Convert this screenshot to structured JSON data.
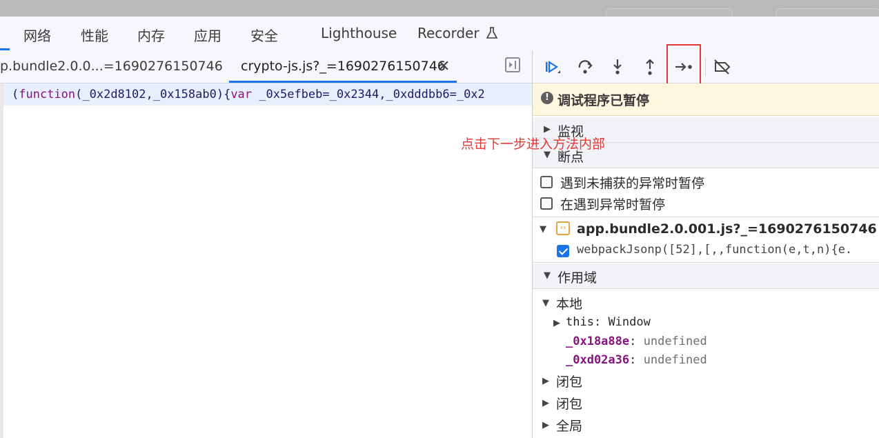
{
  "panel_tabs": [
    "网络",
    "性能",
    "内存",
    "应用",
    "安全",
    "Lighthouse",
    "Recorder"
  ],
  "file_tabs": {
    "first": "p.bundle2.0.0...=1690276150746",
    "second": "crypto-js.js?_=1690276150746",
    "close_glyph": "✕"
  },
  "code": {
    "keyword": "function",
    "open": "(",
    "params": "(_0x2d8102,_0x158ab0){",
    "keyword2": "var",
    "rest": " _0x5efbeb=_0x2344,_0xdddbb6=_0x2"
  },
  "debugger": {
    "buttons": [
      "resume-icon",
      "step-over-icon",
      "step-into-icon",
      "step-out-icon",
      "step-icon",
      "deactivate-breakpoints-icon"
    ],
    "paused_text": "调试程序已暂停",
    "info_glyph": "!"
  },
  "sections": {
    "watch": "监视",
    "breakpoints": "断点",
    "scope": "作用域"
  },
  "breakpoint_options": [
    {
      "label": "遇到未捕获的异常时暂停",
      "checked": false
    },
    {
      "label": "在遇到异常时暂停",
      "checked": false
    }
  ],
  "breakpoint_file": {
    "name": "app.bundle2.0.001.js?_=1690276150746",
    "icon_glyph": "‹›",
    "entry": "webpackJsonp([52],[,,function(e,t,n){e."
  },
  "scope": {
    "local": "本地",
    "this_label": "this",
    "this_value": "Window",
    "vars": [
      {
        "name": "_0x18a88e",
        "value": "undefined"
      },
      {
        "name": "_0xd02a36",
        "value": "undefined"
      }
    ],
    "closures": [
      "闭包",
      "闭包"
    ],
    "global": "全局"
  },
  "annotation": "点击下一步进入方法内部",
  "colors": {
    "accent": "#1a73e8",
    "highlight": "#e53935",
    "paused_bg": "#fef7e0"
  }
}
